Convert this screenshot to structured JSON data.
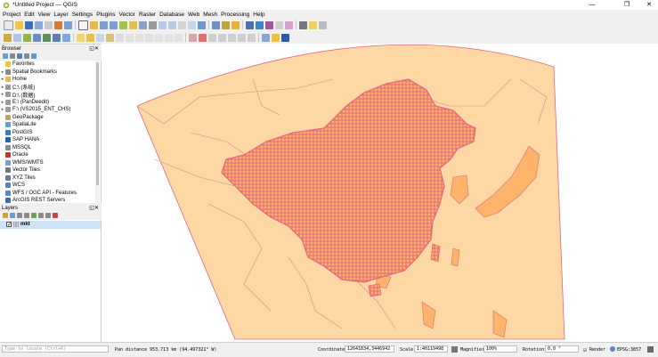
{
  "window": {
    "title": "*Untitled Project — QGIS"
  },
  "menu": [
    "Project",
    "Edit",
    "View",
    "Layer",
    "Settings",
    "Plugins",
    "Vector",
    "Raster",
    "Database",
    "Web",
    "Mesh",
    "Processing",
    "Help"
  ],
  "browser": {
    "title": "Browser",
    "items": [
      {
        "label": "Favorites",
        "icon": "star-icon",
        "arrow": ""
      },
      {
        "label": "Spatial Bookmarks",
        "icon": "bookmark-icon",
        "arrow": "▸"
      },
      {
        "label": "Home",
        "icon": "folder-icon",
        "arrow": "▸"
      },
      {
        "label": "C:\\ (系统)",
        "icon": "drive-icon",
        "arrow": "▸"
      },
      {
        "label": "D:\\ (数据)",
        "icon": "drive-icon",
        "arrow": "▸"
      },
      {
        "label": "E:\\ (PanDeedit)",
        "icon": "drive-icon",
        "arrow": "▸"
      },
      {
        "label": "F:\\ (VS2015_ENT_CHS)",
        "icon": "drive-icon",
        "arrow": "▸"
      },
      {
        "label": "GeoPackage",
        "icon": "geopackage-icon",
        "arrow": ""
      },
      {
        "label": "SpatiaLite",
        "icon": "spatialite-icon",
        "arrow": ""
      },
      {
        "label": "PostGIS",
        "icon": "postgis-icon",
        "arrow": ""
      },
      {
        "label": "SAP HANA",
        "icon": "sap-hana-icon",
        "arrow": ""
      },
      {
        "label": "MSSQL",
        "icon": "mssql-icon",
        "arrow": ""
      },
      {
        "label": "Oracle",
        "icon": "oracle-icon",
        "arrow": ""
      },
      {
        "label": "WMS/WMTS",
        "icon": "wms-icon",
        "arrow": ""
      },
      {
        "label": "Vector Tiles",
        "icon": "vector-tiles-icon",
        "arrow": ""
      },
      {
        "label": "XYZ Tiles",
        "icon": "xyz-tiles-icon",
        "arrow": ""
      },
      {
        "label": "WCS",
        "icon": "wcs-icon",
        "arrow": ""
      },
      {
        "label": "WFS / OGC API - Features",
        "icon": "wfs-icon",
        "arrow": ""
      },
      {
        "label": "ArcGIS REST Servers",
        "icon": "arcgis-icon",
        "arrow": ""
      }
    ]
  },
  "layers": {
    "title": "Layers",
    "items": [
      {
        "label": "mkt",
        "checked": true
      }
    ]
  },
  "status": {
    "locate_placeholder": "Type to locate (Ctrl+K)",
    "message": "Pan distance 953.713 km (94.497321° W)",
    "coordinate_label": "Coordinate",
    "coordinate_value": "12641834,3446942",
    "scale_label": "Scale",
    "scale_value": "1:40119498",
    "magnifier_label": "Magnifier",
    "magnifier_value": "100%",
    "rotation_label": "Rotation",
    "rotation_value": "0.0 °",
    "render_label": "Render",
    "crs_label": "EPSG:3857"
  },
  "colors": {
    "land_fill": "#fdd8a5",
    "layer_fill": "#fbb46a",
    "layer_stroke": "#e6657e"
  }
}
